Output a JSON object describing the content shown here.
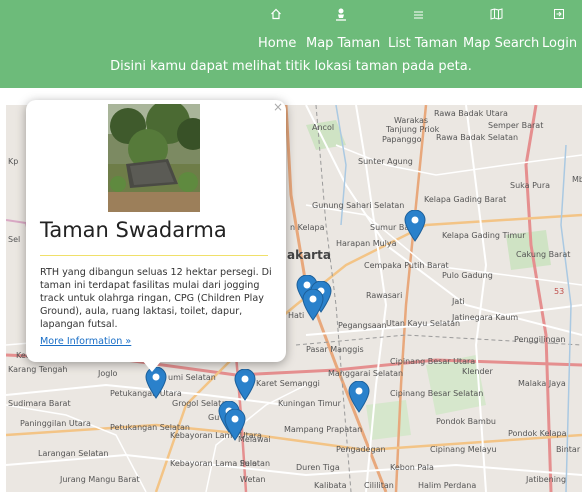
{
  "nav": {
    "items": [
      {
        "label": "Home",
        "icon": "home-icon"
      },
      {
        "label": "Map Taman",
        "icon": "map-pin-person-icon"
      },
      {
        "label": "List Taman",
        "icon": "list-icon"
      },
      {
        "label": "Map Search",
        "icon": "map-fold-icon"
      },
      {
        "label": "Login",
        "icon": "login-icon"
      }
    ],
    "tagline": "Disini kamu dapat melihat titik lokasi taman pada peta."
  },
  "popup": {
    "title": "Taman Swadarma",
    "description": "RTH yang dibangun seluas 12 hektar persegi. Di taman ini terdapat fasilitas mulai dari jogging track untuk olahrga ringan, CPG (Children Play Ground), aula, ruang laktasi, toilet, dapur, lapangan futsal.",
    "link": "More Information »",
    "close": "×"
  },
  "map": {
    "places": [
      {
        "id": "ancol",
        "text": "Ancol"
      },
      {
        "id": "warakas",
        "text": "Warakas"
      },
      {
        "id": "tanjung-priok",
        "text": "Tanjung Priok"
      },
      {
        "id": "rawa-badak-utara",
        "text": "Rawa Badak Utara"
      },
      {
        "id": "rawa-badak-selatan",
        "text": "Rawa Badak Selatan"
      },
      {
        "id": "semper-barat",
        "text": "Semper Barat"
      },
      {
        "id": "papanggo",
        "text": "Papanggo"
      },
      {
        "id": "sunter-agung",
        "text": "Sunter Agung"
      },
      {
        "id": "sumur-batu",
        "text": "Sumur Batu"
      },
      {
        "id": "suka-pura",
        "text": "Suka Pura"
      },
      {
        "id": "kelapa-gading-barat",
        "text": "Kelapa Gading Barat"
      },
      {
        "id": "kelapa-gading-timur",
        "text": "Kelapa Gading Timur"
      },
      {
        "id": "cakung-barat",
        "text": "Cakung Barat"
      },
      {
        "id": "gunung-sahari-selatan",
        "text": "Gunung Sahari Selatan"
      },
      {
        "id": "harapan-mulya",
        "text": "Harapan Mulya"
      },
      {
        "id": "cempaka-putih-barat",
        "text": "Cempaka Putih Barat"
      },
      {
        "id": "pulo-gadung",
        "text": "Pulo Gadung"
      },
      {
        "id": "jakarta",
        "text": "akarta"
      },
      {
        "id": "rawasari",
        "text": "Rawasari"
      },
      {
        "id": "jati",
        "text": "Jati"
      },
      {
        "id": "jatinegara-kaum",
        "text": "Jatinegara Kaum"
      },
      {
        "id": "pegangsaan",
        "text": "Pegangsaan"
      },
      {
        "id": "utan-kayu-selatan",
        "text": "Utan Kayu Selatan"
      },
      {
        "id": "penggilingan",
        "text": "Penggilingan"
      },
      {
        "id": "pasar-manggis",
        "text": "Pasar Manggis"
      },
      {
        "id": "cipinang-besar-utara",
        "text": "Cipinang Besar Utara"
      },
      {
        "id": "klender",
        "text": "Klender"
      },
      {
        "id": "malaka-jaya",
        "text": "Malaka Jaya"
      },
      {
        "id": "manggarai-selatan",
        "text": "Manggarai Selatan"
      },
      {
        "id": "cipinang-besar-selatan",
        "text": "Cipinang Besar Selatan"
      },
      {
        "id": "pondok-bambu",
        "text": "Pondok Bambu"
      },
      {
        "id": "pondok-kelapa",
        "text": "Pondok Kelapa"
      },
      {
        "id": "karet-semanggi",
        "text": "Karet Semanggi"
      },
      {
        "id": "kuningan-timur",
        "text": "Kuningan Timur"
      },
      {
        "id": "karang-tengah",
        "text": "Karang Tengah"
      },
      {
        "id": "joglo",
        "text": "Joglo"
      },
      {
        "id": "petukangan-utara",
        "text": "Petukangan Utara"
      },
      {
        "id": "grogol-selatan",
        "text": "Grogol Selatan"
      },
      {
        "id": "sudimara-barat",
        "text": "Sudimara Barat"
      },
      {
        "id": "paninggilan-utara",
        "text": "Paninggilan Utara"
      },
      {
        "id": "petukangan-selatan",
        "text": "Petukangan Selatan"
      },
      {
        "id": "kebayoran-lama-utara",
        "text": "Kebayoran Lama Utara"
      },
      {
        "id": "melawai",
        "text": "Melawai"
      },
      {
        "id": "mampang-prapatan",
        "text": "Mampang Prapatan"
      },
      {
        "id": "pengadegan",
        "text": "Pengadegan"
      },
      {
        "id": "cipinang-melayu",
        "text": "Cipinang Melayu"
      },
      {
        "id": "bintaro",
        "text": "Bintar"
      },
      {
        "id": "larangan-selatan",
        "text": "Larangan Selatan"
      },
      {
        "id": "kebayoran-lama-selatan",
        "text": "Kebayoran Lama Selatan"
      },
      {
        "id": "pulo",
        "text": "Pulo"
      },
      {
        "id": "duren-tiga",
        "text": "Duren Tiga"
      },
      {
        "id": "kebon-pala",
        "text": "Kebon Pala"
      },
      {
        "id": "jurang-mangu-barat",
        "text": "Jurang Mangu Barat"
      },
      {
        "id": "kalibata",
        "text": "Kalibata"
      },
      {
        "id": "cililitan",
        "text": "Cililitan"
      },
      {
        "id": "halim-perdana",
        "text": "Halim Perdana"
      },
      {
        "id": "jatibening",
        "text": "Jatibening"
      },
      {
        "id": "gumi-selatan",
        "text": "umi Selatan"
      },
      {
        "id": "kebun-kelapa",
        "text": "n Kelapa"
      },
      {
        "id": "hati",
        "text": "Hati"
      },
      {
        "id": "kedoya",
        "text": "Ked"
      },
      {
        "id": "num-53",
        "text": "53"
      },
      {
        "id": "sel",
        "text": "Sel"
      },
      {
        "id": "kp",
        "text": "Kp"
      },
      {
        "id": "mb",
        "text": "Mb"
      },
      {
        "id": "gu",
        "text": "Gu"
      },
      {
        "id": "wetan",
        "text": "Wetan"
      }
    ]
  }
}
